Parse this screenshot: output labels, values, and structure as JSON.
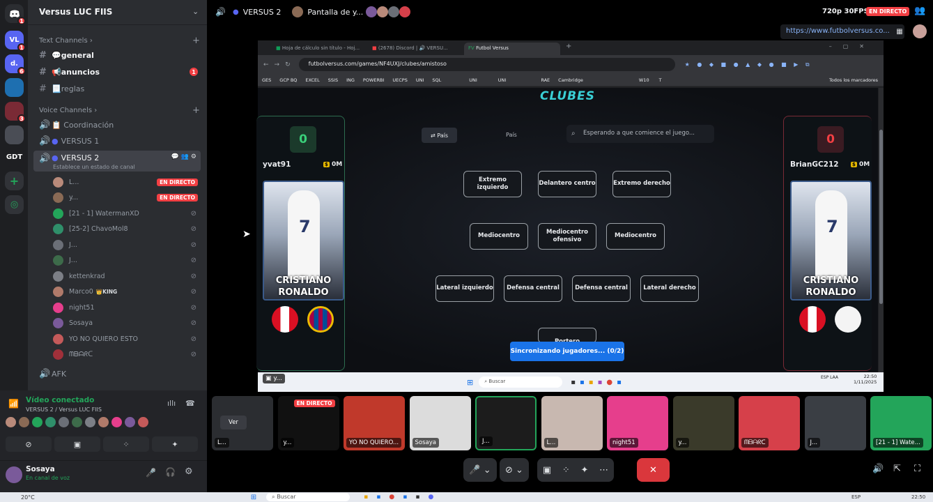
{
  "server": {
    "name": "Versus LUC FIIS"
  },
  "server_rail": [
    {
      "label": "",
      "badge": "1"
    },
    {
      "label": "VL",
      "badge": "1"
    },
    {
      "label": "d.",
      "badge": "6"
    },
    {
      "label": "",
      "badge": ""
    },
    {
      "label": "",
      "badge": "3"
    },
    {
      "label": "",
      "badge": ""
    },
    {
      "label": "GDT",
      "badge": ""
    }
  ],
  "text_category": "Text Channels",
  "text_channels": [
    {
      "name": "💬general",
      "badge": ""
    },
    {
      "name": "📢anuncios",
      "badge": "1"
    },
    {
      "name": "📃reglas",
      "badge": ""
    }
  ],
  "voice_category": "Voice Channels",
  "voice_channels": [
    "📋 Coordinación",
    "VERSUS 1",
    "VERSUS 2",
    "AFK"
  ],
  "voice_status": "Establece un estado de canal",
  "voice_users": [
    {
      "name": "L...",
      "live": "EN DIRECTO",
      "color": "#b98a7a"
    },
    {
      "name": "y...",
      "live": "EN DIRECTO",
      "color": "#8a6a55"
    },
    {
      "name": "[21 - 1] WatermanXD",
      "live": "",
      "color": "#23a55a"
    },
    {
      "name": "[25-2] ChavoMol8",
      "live": "",
      "color": "#2f8f6a"
    },
    {
      "name": "J...",
      "live": "",
      "color": "#6b6f77"
    },
    {
      "name": "J...",
      "live": "",
      "color": "#3d6b4a"
    },
    {
      "name": "kettenkrad",
      "live": "",
      "color": "#7c7f86"
    },
    {
      "name": "Marco0",
      "live": "",
      "color": "#b07a6a",
      "tag": "👑KING"
    },
    {
      "name": "night51",
      "live": "",
      "color": "#e63e8c"
    },
    {
      "name": "Sosaya",
      "live": "",
      "color": "#7a5a9a"
    },
    {
      "name": "YO NO QUIERO ESTO",
      "live": "",
      "color": "#c45a5a"
    },
    {
      "name": "ᗰᗷᗩᖇᑕ",
      "live": "",
      "color": "#a0303a"
    }
  ],
  "voice_panel": {
    "title": "Vídeo conectado",
    "subtitle": "VERSUS 2 / Versus LUC FIIS"
  },
  "user_panel": {
    "name": "Sosaya",
    "status": "En canal de voz"
  },
  "top": {
    "channel": "VERSUS 2",
    "stream": "Pantalla de y...",
    "quality": "720p 30FPS",
    "live": "EN DIRECTO",
    "url": "https://www.futbolversus.co..."
  },
  "browser": {
    "tabs": [
      "Hoja de cálculo sin título - Hoj...",
      "(2678) Discord | 🔊 VERSU...",
      "Futbol Versus"
    ],
    "address": "futbolversus.com/games/NF4UXJ/clubes/amistoso",
    "bookmarks": [
      "GES",
      "GCP BQ",
      "EXCEL",
      "SSIS",
      "ING",
      "POWERBI",
      "UECPS",
      "UNI",
      "SQL",
      "UNI",
      "UNI",
      "RAE",
      "Cambridge",
      "W10",
      "T",
      "Todos los marcadores"
    ]
  },
  "game": {
    "title": "CLUBES",
    "toggle": "⇄ País",
    "mode": "País",
    "search_placeholder": "Esperando a que comience el juego...",
    "left_player": {
      "score": "0",
      "name": "yvat91",
      "coins": "0M",
      "card_first": "CRISTIANO",
      "card_last": "RONALDO"
    },
    "right_player": {
      "score": "0",
      "name": "BrianGC212",
      "coins": "0M",
      "card_first": "CRISTIANO",
      "card_last": "RONALDO"
    },
    "positions": {
      "ei": "Extremo izquierdo",
      "dc": "Delantero centro",
      "ed": "Extremo derecho",
      "mc1": "Mediocentro",
      "mco": "Mediocentro ofensivo",
      "mc2": "Mediocentro",
      "li": "Lateral izquierdo",
      "dfc1": "Defensa central",
      "dfc2": "Defensa central",
      "ld": "Lateral derecho",
      "por": "Portero"
    },
    "sync": "Sincronizando jugadores... (0/2)"
  },
  "win_taskbar": {
    "search": "Buscar",
    "lang": "ESP LAA",
    "time": "22:50",
    "date": "1/11/2025"
  },
  "streamer_label": "y...",
  "tiles": [
    {
      "label": "L...",
      "extra": "Ver",
      "color": "#2b2d31"
    },
    {
      "label": "y...",
      "extra": "EN DIRECTO",
      "color": "#111"
    },
    {
      "label": "YO NO QUIERO...",
      "extra": "",
      "color": "#c0392b"
    },
    {
      "label": "Sosaya",
      "extra": "",
      "color": "#dcdcdc"
    },
    {
      "label": "J...",
      "extra": "",
      "color": "#1c1c1c"
    },
    {
      "label": "L...",
      "extra": "",
      "color": "#c8b8b0"
    },
    {
      "label": "night51",
      "extra": "",
      "color": "#e63e8c"
    },
    {
      "label": "y...",
      "extra": "",
      "color": "#3a3a2a"
    },
    {
      "label": "ᗰᗷᗩᖇᑕ",
      "extra": "",
      "color": "#d6404a"
    },
    {
      "label": "J...",
      "extra": "",
      "color": "#3a3e44"
    },
    {
      "label": "[21 - 1] Wate...",
      "extra": "",
      "color": "#23a55a"
    }
  ],
  "os_taskbar": {
    "temp": "20°C",
    "search": "Buscar",
    "lang": "ESP",
    "time": "22:50"
  }
}
